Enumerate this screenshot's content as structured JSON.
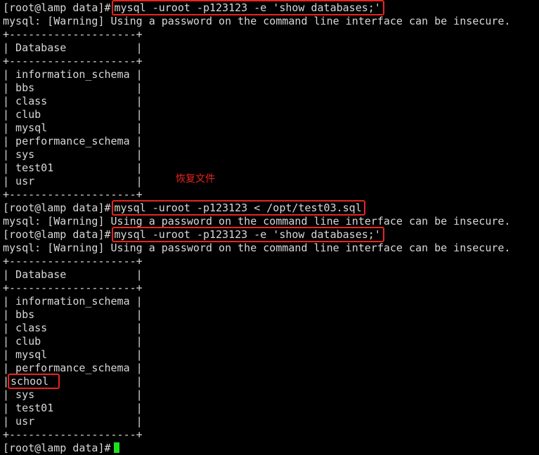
{
  "prompt": "[root@lamp data]#",
  "commands": {
    "show1": "mysql -uroot -p123123 -e 'show databases;'",
    "restore": "mysql -uroot -p123123 < /opt/test03.sql",
    "show2": "mysql -uroot -p123123 -e 'show databases;'"
  },
  "warning": "mysql: [Warning] Using a password on the command line interface can be insecure.",
  "table_border": "+--------------------+",
  "table_header": "| Database           |",
  "first_result": [
    "information_schema",
    "bbs",
    "class",
    "club",
    "mysql",
    "performance_schema",
    "sys",
    "test01",
    "usr"
  ],
  "second_result": [
    "information_schema",
    "bbs",
    "class",
    "club",
    "mysql",
    "performance_schema",
    "school",
    "sys",
    "test01",
    "usr"
  ],
  "annotation": "恢复文件",
  "last_prompt": "[root@lamp data]#"
}
